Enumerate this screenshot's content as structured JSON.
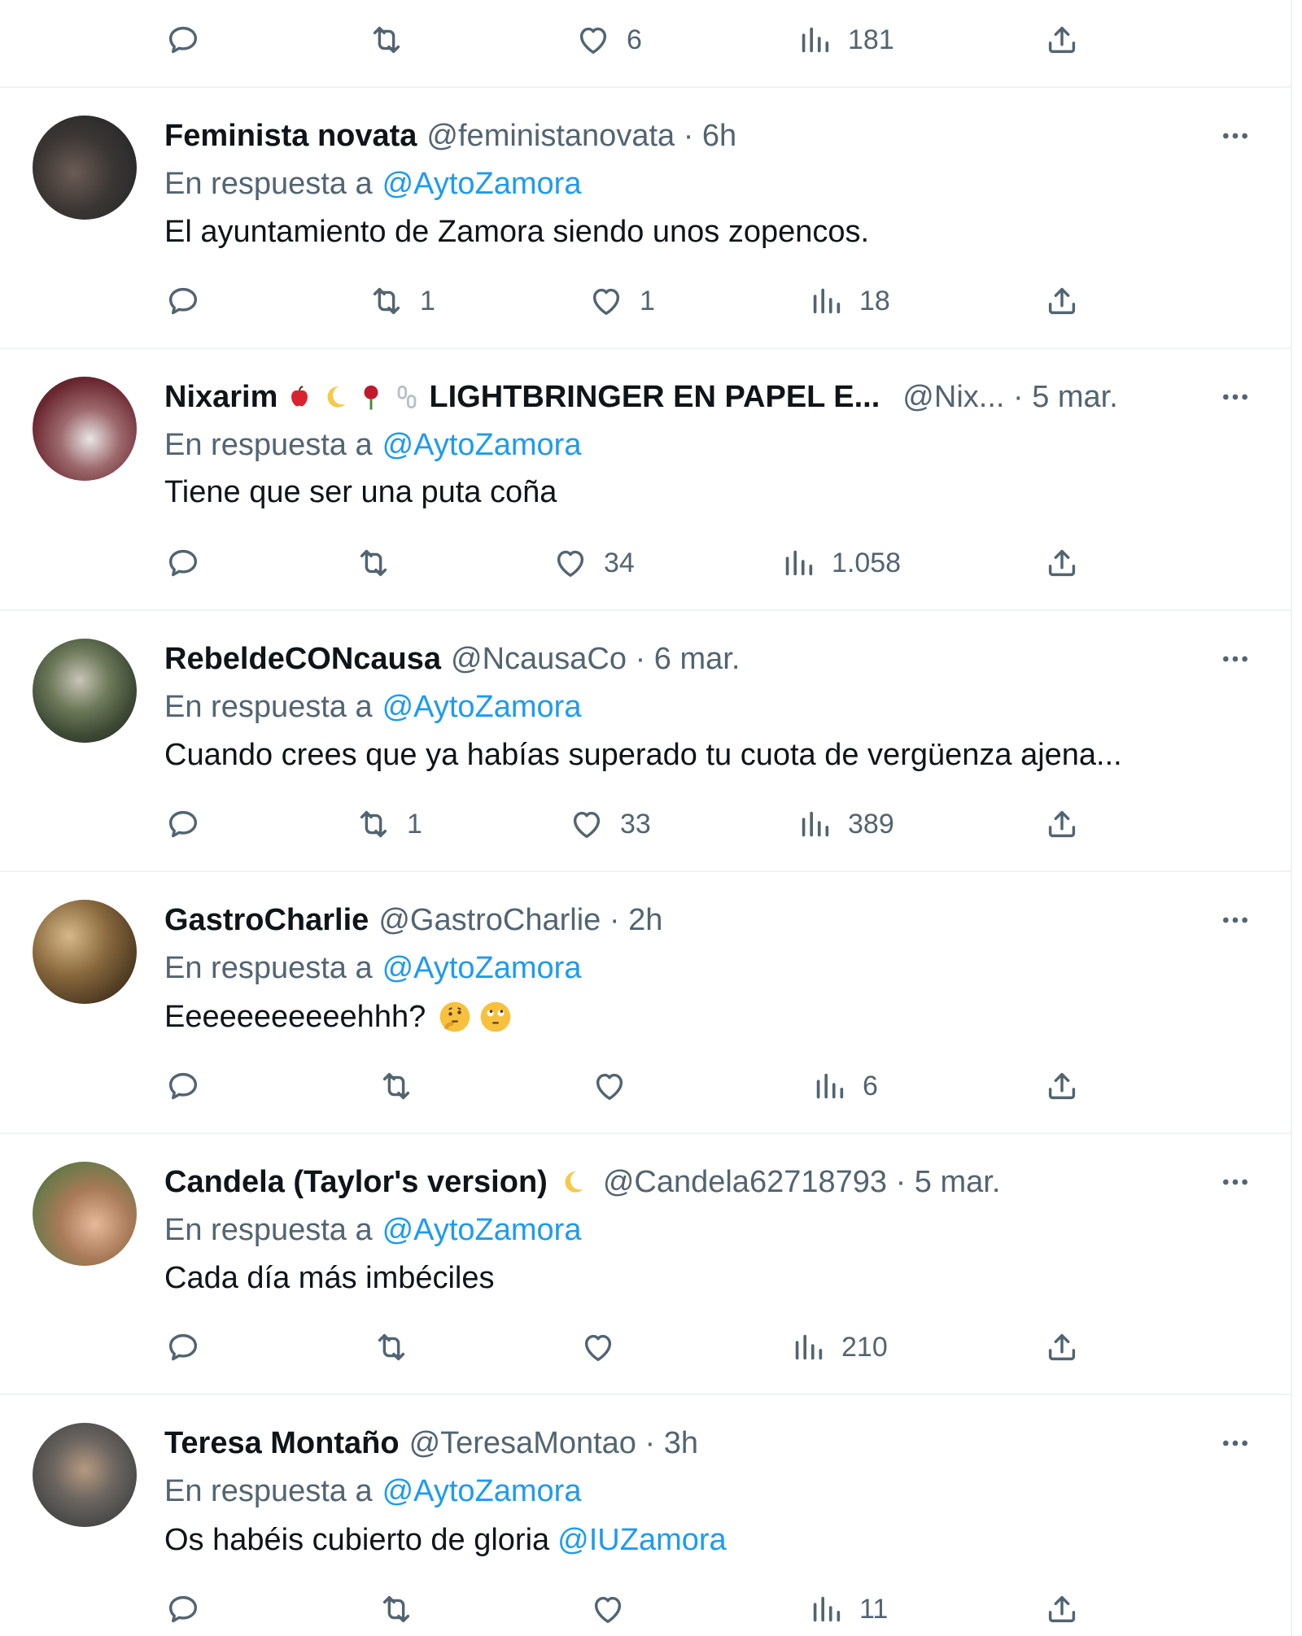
{
  "top_actions": {
    "reply_count": "",
    "retweet_count": "",
    "like_count": "6",
    "view_count": "181"
  },
  "tweets": [
    {
      "name": "Feminista novata",
      "handle": "@feministanovata · 6h",
      "reply_prefix": "En respuesta a",
      "reply_to": "@AytoZamora",
      "text": "El ayuntamiento de Zamora siendo unos zopencos.",
      "mention": "",
      "retweets": "1",
      "likes": "1",
      "views": "18"
    },
    {
      "name": "Nixarim",
      "name_suffix": "LIGHTBRINGER EN PAPEL E...",
      "name_emoji": [
        "apple-emoji",
        "moon-emoji",
        "rose-emoji",
        "chain-emoji"
      ],
      "handle": "@Nix... · 5 mar.",
      "reply_prefix": "En respuesta a",
      "reply_to": "@AytoZamora",
      "text": "Tiene que ser una puta coña",
      "mention": "",
      "retweets": "",
      "likes": "34",
      "views": "1.058"
    },
    {
      "name": "RebeldeCONcausa",
      "handle": "@NcausaCo · 6 mar.",
      "reply_prefix": "En respuesta a",
      "reply_to": "@AytoZamora",
      "text": "Cuando crees que ya habías superado tu cuota de vergüenza ajena...",
      "mention": "",
      "retweets": "1",
      "likes": "33",
      "views": "389"
    },
    {
      "name": "GastroCharlie",
      "handle": "@GastroCharlie · 2h",
      "reply_prefix": "En respuesta a",
      "reply_to": "@AytoZamora",
      "text": "Eeeeeeeeeeehhh?",
      "text_emoji": [
        "thinking-face-emoji",
        "rolling-eyes-emoji"
      ],
      "mention": "",
      "retweets": "",
      "likes": "",
      "views": "6"
    },
    {
      "name": "Candela (Taylor's version)",
      "name_emoji": [
        "moon-emoji"
      ],
      "handle": "@Candela62718793 · 5 mar.",
      "reply_prefix": "En respuesta a",
      "reply_to": "@AytoZamora",
      "text": "Cada día más imbéciles",
      "mention": "",
      "retweets": "",
      "likes": "",
      "views": "210"
    },
    {
      "name": "Teresa Montaño",
      "handle": "@TeresaMontao · 3h",
      "reply_prefix": "En respuesta a",
      "reply_to": "@AytoZamora",
      "text": "Os habéis cubierto de gloria",
      "mention": "@IUZamora",
      "retweets": "",
      "likes": "",
      "views": "11"
    }
  ],
  "colors": {
    "text": "#0f1419",
    "secondary": "#536471",
    "link": "#1d9bf0",
    "separator": "#eff3f4"
  }
}
